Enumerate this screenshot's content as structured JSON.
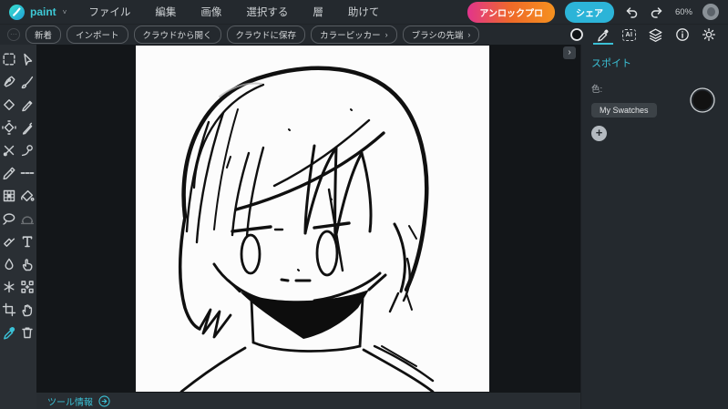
{
  "header": {
    "logo_text": "paint",
    "logo_chevron": "˅",
    "menu": [
      {
        "label": "ファイル"
      },
      {
        "label": "編集"
      },
      {
        "label": "画像"
      },
      {
        "label": "選択する"
      },
      {
        "label": "層"
      },
      {
        "label": "助けて"
      }
    ],
    "unlock_pro_label": "アンロックプロ",
    "share_label": "シェア",
    "zoom_level": "60%"
  },
  "quickbar": {
    "more_icon": "⋯",
    "pills": [
      {
        "label": "新着"
      },
      {
        "label": "インポート"
      },
      {
        "label": "クラウドから開く"
      },
      {
        "label": "クラウドに保存"
      },
      {
        "label": "カラーピッカー",
        "chevron": "›"
      },
      {
        "label": "ブラシの先端",
        "chevron": "›"
      }
    ],
    "ai_label": "AI",
    "right_icons": [
      "current-color",
      "eyedropper",
      "ai-tools",
      "layers",
      "info",
      "settings"
    ],
    "active_right_icon": "eyedropper"
  },
  "left_toolbar": {
    "tools": [
      "marquee-select",
      "arrow-select",
      "pen",
      "brush",
      "eraser",
      "pencil",
      "transform-select",
      "ink-pen",
      "cut",
      "ink-dab",
      "marker",
      "dashed-line",
      "pixelate",
      "fill-bucket",
      "lasso",
      "dome",
      "eraser-stick",
      "text",
      "blur-drop",
      "smudge-finger",
      "spray-frost",
      "arrange-grid",
      "crop",
      "hand",
      "color-picker",
      "trash"
    ],
    "active_tool": "color-picker"
  },
  "canvas": {
    "artwork": "hand-drawn monochrome anime-style portrait sketch",
    "collapse_chevron": "›"
  },
  "panel": {
    "title": "スポイト",
    "color_label": "色:",
    "swatches_button": "My Swatches",
    "add_button": "+",
    "current_color": "#121212"
  },
  "statusbar": {
    "tool_info_label": "ツール情報"
  },
  "colors": {
    "accent_teal": "#3bc1d6",
    "unlock_gradient_start": "#e2348c",
    "unlock_gradient_end": "#f5911f",
    "share_button": "#2cb4d8",
    "canvas_background": "#131619",
    "panel_background": "#24292e"
  }
}
